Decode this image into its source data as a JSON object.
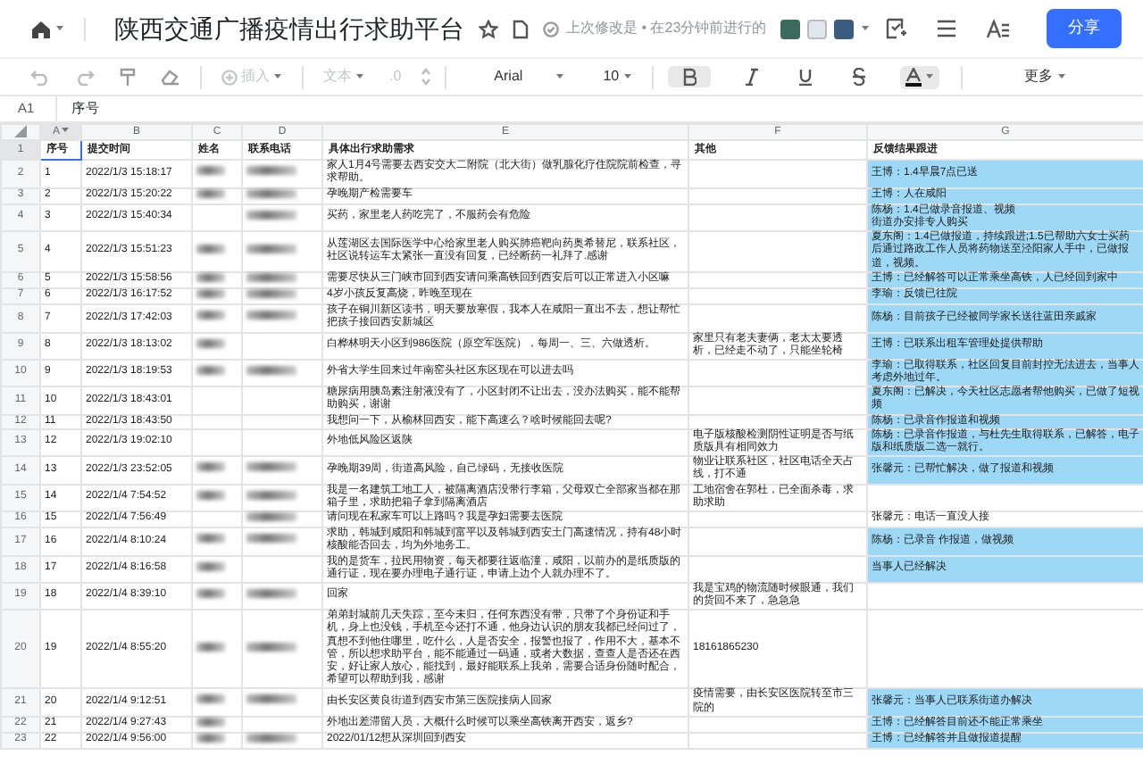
{
  "app": {
    "title": "陕西交通广播疫情出行求助平台",
    "last_edit": "上次修改是 • 在23分钟前进行的",
    "share_button": "分享"
  },
  "toolbar": {
    "insert": {
      "label": "插入",
      "disabled": true
    },
    "text_format": {
      "label": "文本",
      "disabled": true
    },
    "decimal": ".0",
    "font": "Arial",
    "font_size": "10",
    "bold": {
      "selected": true
    },
    "more": "更多"
  },
  "formula_bar": {
    "cell_ref": "A1",
    "value": "序号"
  },
  "columns": [
    {
      "label": "A",
      "selected": true
    },
    {
      "label": "B",
      "selected": false
    },
    {
      "label": "C",
      "selected": false
    },
    {
      "label": "D",
      "selected": false
    },
    {
      "label": "E",
      "selected": false
    },
    {
      "label": "F",
      "selected": false
    },
    {
      "label": "G",
      "selected": false
    }
  ],
  "header_row": {
    "number": "1",
    "cells": [
      "序号",
      "提交时间",
      "姓名",
      "联系电话",
      "具体出行求助需求",
      "其他",
      "反馈结果跟进"
    ]
  },
  "rows": [
    {
      "number": "2",
      "index": "1",
      "time": "2022/1/3 15:18:17",
      "name_hidden": true,
      "phone_hidden": true,
      "request": "家人1月4号需要去西安交大二附院（北大街）做乳腺化疗住院院前检查，寻求帮助。",
      "feedback": "王博：1.4早晨7点已送",
      "highlighted": true
    },
    {
      "number": "3",
      "index": "2",
      "time": "2022/1/3 15:20:22",
      "name_hidden": true,
      "phone_hidden": true,
      "request": "孕晚期产检需要车",
      "feedback": "王博：人在咸阳",
      "highlighted": true
    },
    {
      "number": "4",
      "index": "3",
      "time": "2022/1/3 15:40:34",
      "name_hidden": false,
      "phone_hidden": true,
      "request": "买药，家里老人药吃完了，不服药会有危险",
      "feedback": "陈杨：1.4已做录音报道、视频",
      "feedback_note": "街道办安排专人购买",
      "highlighted": true
    },
    {
      "number": "5",
      "index": "4",
      "time": "2022/1/3 15:51:23",
      "name_hidden": true,
      "phone_hidden": true,
      "request": "从莲湖区去国际医学中心给家里老人购买肺癌靶向药奥希替尼，联系社区，社区说转运车太紧张一直没有回复，已经断药一礼拜了.感谢",
      "feedback": "夏东阁：1.4已做报道，持续跟进;1.5已帮助六女士买药后通过路政工作人员将药物送至泾阳家人手中，已做报道，视频。",
      "highlighted": true
    },
    {
      "number": "6",
      "index": "5",
      "time": "2022/1/3 15:58:56",
      "name_hidden": true,
      "phone_hidden": true,
      "request": "需要尽快从三门峡市回到西安请问乘高铁回到西安后可以正常进入小区嘛",
      "feedback": "王博：已经解答可以正常乘坐高铁，人已经回到家中",
      "highlighted": true
    },
    {
      "number": "7",
      "index": "6",
      "time": "2022/1/3 16:17:52",
      "name_hidden": true,
      "phone_hidden": true,
      "request": "4岁小孩反复高烧，昨晚至现在",
      "feedback": "李瑜：反馈已往院",
      "highlighted": true
    },
    {
      "number": "8",
      "index": "7",
      "time": "2022/1/3 17:42:03",
      "name_hidden": true,
      "phone_hidden": true,
      "request": "孩子在铜川新区读书，明天要放寒假，我本人在咸阳一直出不去，想让帮忙把孩子接回西安新城区",
      "feedback": "陈杨：目前孩子已经被同学家长送往蓝田亲戚家",
      "highlighted": true
    },
    {
      "number": "9",
      "index": "8",
      "time": "2022/1/3 18:13:02",
      "name_hidden": true,
      "phone_hidden": false,
      "request": "白桦林明天小区到986医院（原空军医院），每周一、三、六做透析。",
      "other": "家里只有老夫妻俩，老太太要透析，已经走不动了，只能坐轮椅",
      "feedback": "王博：已联系出租车管理处提供帮助",
      "highlighted": true
    },
    {
      "number": "10",
      "index": "9",
      "time": "2022/1/3 18:19:53",
      "name_hidden": true,
      "phone_hidden": true,
      "request": "外省大学生回来过年南窑头社区东区现在可以进去吗",
      "feedback": "李瑜：已取得联系，社区回复目前封控无法进去，当事人考虑外地过年。",
      "highlighted": true
    },
    {
      "number": "11",
      "index": "10",
      "time": "2022/1/3 18:43:01",
      "name_hidden": false,
      "phone_hidden": false,
      "request": "糖尿病用胰岛素注射液没有了，小区封闭不让出去，没办法购买，能不能帮助购买，谢谢",
      "feedback": "夏东阁：已解决，今天社区志愿者帮他购买，已做了短视频",
      "highlighted": true
    },
    {
      "number": "12",
      "index": "11",
      "time": "2022/1/3 18:43:50",
      "name_hidden": false,
      "phone_hidden": false,
      "request": "我想问一下，从榆林回西安，能下高速么？啥时候能回去呢?",
      "feedback": "陈杨：已录音作报道和视频",
      "highlighted": true
    },
    {
      "number": "13",
      "index": "12",
      "time": "2022/1/3 19:02:10",
      "name_hidden": false,
      "phone_hidden": false,
      "request": "外地低风险区返陕",
      "other": "电子版核酸检测阴性证明是否与纸质版具有相同效力",
      "feedback": "陈杨：已录音作报道，与杜先生取得联系，已解答，电子版和纸质版二选一就行。",
      "highlighted": true
    },
    {
      "number": "14",
      "index": "13",
      "time": "2022/1/3 23:52:05",
      "name_hidden": true,
      "phone_hidden": true,
      "request": "孕晚期39周，街道高风险，自己绿码，无接收医院",
      "other": "物业让联系社区，社区电话全天占线，打不通",
      "feedback": "张馨元：已帮忙解决，做了报道和视频",
      "highlighted": true
    },
    {
      "number": "15",
      "index": "14",
      "time": "2022/1/4 7:54:52",
      "name_hidden": true,
      "phone_hidden": true,
      "request": "我是一名建筑工地工人，被隔离酒店没带行李箱，父母双亡全部家当都在那箱子里，求助把箱子拿到隔离酒店",
      "other": "工地宿舍在郭杜，已全面杀毒，求助求助",
      "highlighted": false
    },
    {
      "number": "16",
      "index": "15",
      "time": "2022/1/4 7:56:49",
      "name_hidden": false,
      "phone_hidden": true,
      "request": "请问现在私家车可以上路吗？我是孕妇需要去医院",
      "feedback": "张馨元：电话一直没人接",
      "highlighted": false
    },
    {
      "number": "17",
      "index": "16",
      "time": "2022/1/4 8:10:24",
      "name_hidden": true,
      "phone_hidden": true,
      "request": "求助，韩城到咸阳和韩城到富平以及韩城到西安土门高速情况，持有48小时核酸能否回去，均为外地务工。",
      "feedback": "陈杨：已录音 作报道，做视频",
      "highlighted": true
    },
    {
      "number": "18",
      "index": "17",
      "time": "2022/1/4 8:16:58",
      "name_hidden": true,
      "phone_hidden": false,
      "request": "我的是货车，拉民用物资，每天都要往返临潼，咸阳，以前办的是纸质版的通行证，现在要办理电子通行证，申请上边个人就办理不了。",
      "feedback": "当事人已经解决",
      "highlighted": true
    },
    {
      "number": "19",
      "index": "18",
      "time": "2022/1/4 8:39:10",
      "name_hidden": true,
      "phone_hidden": true,
      "request": "回家",
      "other": "我是宝鸡的物流随时候眼通，我们的货回不来了，急急急",
      "highlighted": false
    },
    {
      "number": "20",
      "index": "19",
      "time": "2022/1/4 8:55:20",
      "name_hidden": true,
      "phone_hidden": true,
      "request": "弟弟封城前几天失踪，至今未归，任何东西没有带，只带了个身份证和手机，身上也没钱，手机至今还打不通，他身边认识的朋友我都已经问过了，真想不到他住哪里，吃什么，人是否安全，报警也报了，作用不大，基本不管，所以想求助平台，能不能通过一码通，或者大数据，查查人是否还在西安，好让家人放心，能找到，最好能联系上我弟，需要合适身份随时配合，希望可以帮助到我，感谢",
      "other": "18161865230",
      "highlighted": false
    },
    {
      "number": "21",
      "index": "20",
      "time": "2022/1/4 9:12:51",
      "name_hidden": true,
      "phone_hidden": true,
      "request": "由长安区黄良街道到西安市第三医院接病人回家",
      "other": "疫情需要，由长安区医院转至市三院的",
      "feedback": "张馨元：当事人已联系街道办解决",
      "highlighted": true
    },
    {
      "number": "22",
      "index": "21",
      "time": "2022/1/4 9:27:43",
      "name_hidden": true,
      "phone_hidden": false,
      "request": "外地出差滞留人员，大概什么时候可以乘坐高铁离开西安，返乡?",
      "feedback": "王博：已经解答目前还不能正常乘坐",
      "highlighted": true
    },
    {
      "number": "23",
      "index": "22",
      "time": "2022/1/4 9:56:00",
      "name_hidden": true,
      "phone_hidden": true,
      "request": "2022/01/12想从深圳回到西安",
      "feedback": "王博：已经解答并且做报道提醒",
      "highlighted": true
    }
  ]
}
